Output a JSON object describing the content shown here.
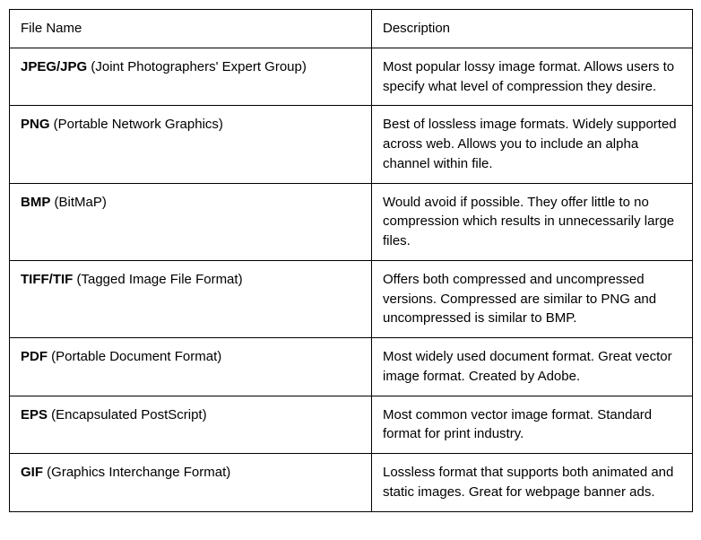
{
  "headers": {
    "fileName": "File Name",
    "description": "Description"
  },
  "rows": [
    {
      "abbr": "JPEG/JPG",
      "full": " (Joint Photographers' Expert Group)",
      "description": "Most popular lossy image format. Allows users to specify what level of compression they desire."
    },
    {
      "abbr": "PNG",
      "full": " (Portable Network Graphics)",
      "description": "Best of lossless image formats. Widely supported across web. Allows you to include an alpha channel within file."
    },
    {
      "abbr": "BMP",
      "full": " (BitMaP)",
      "description": "Would avoid if possible. They offer little to no compression which results in unnecessarily large files."
    },
    {
      "abbr": "TIFF/TIF",
      "full": " (Tagged Image File Format)",
      "description": "Offers both compressed and uncompressed versions. Compressed are similar to PNG and uncompressed is similar to BMP."
    },
    {
      "abbr": "PDF",
      "full": " (Portable Document Format)",
      "description": "Most widely used document format. Great vector image format. Created by Adobe."
    },
    {
      "abbr": "EPS",
      "full": " (Encapsulated PostScript)",
      "description": "Most common vector image format. Standard format for print industry."
    },
    {
      "abbr": "GIF",
      "full": " (Graphics Interchange Format)",
      "description": "Lossless format that supports both animated and static images. Great for webpage banner ads."
    }
  ]
}
